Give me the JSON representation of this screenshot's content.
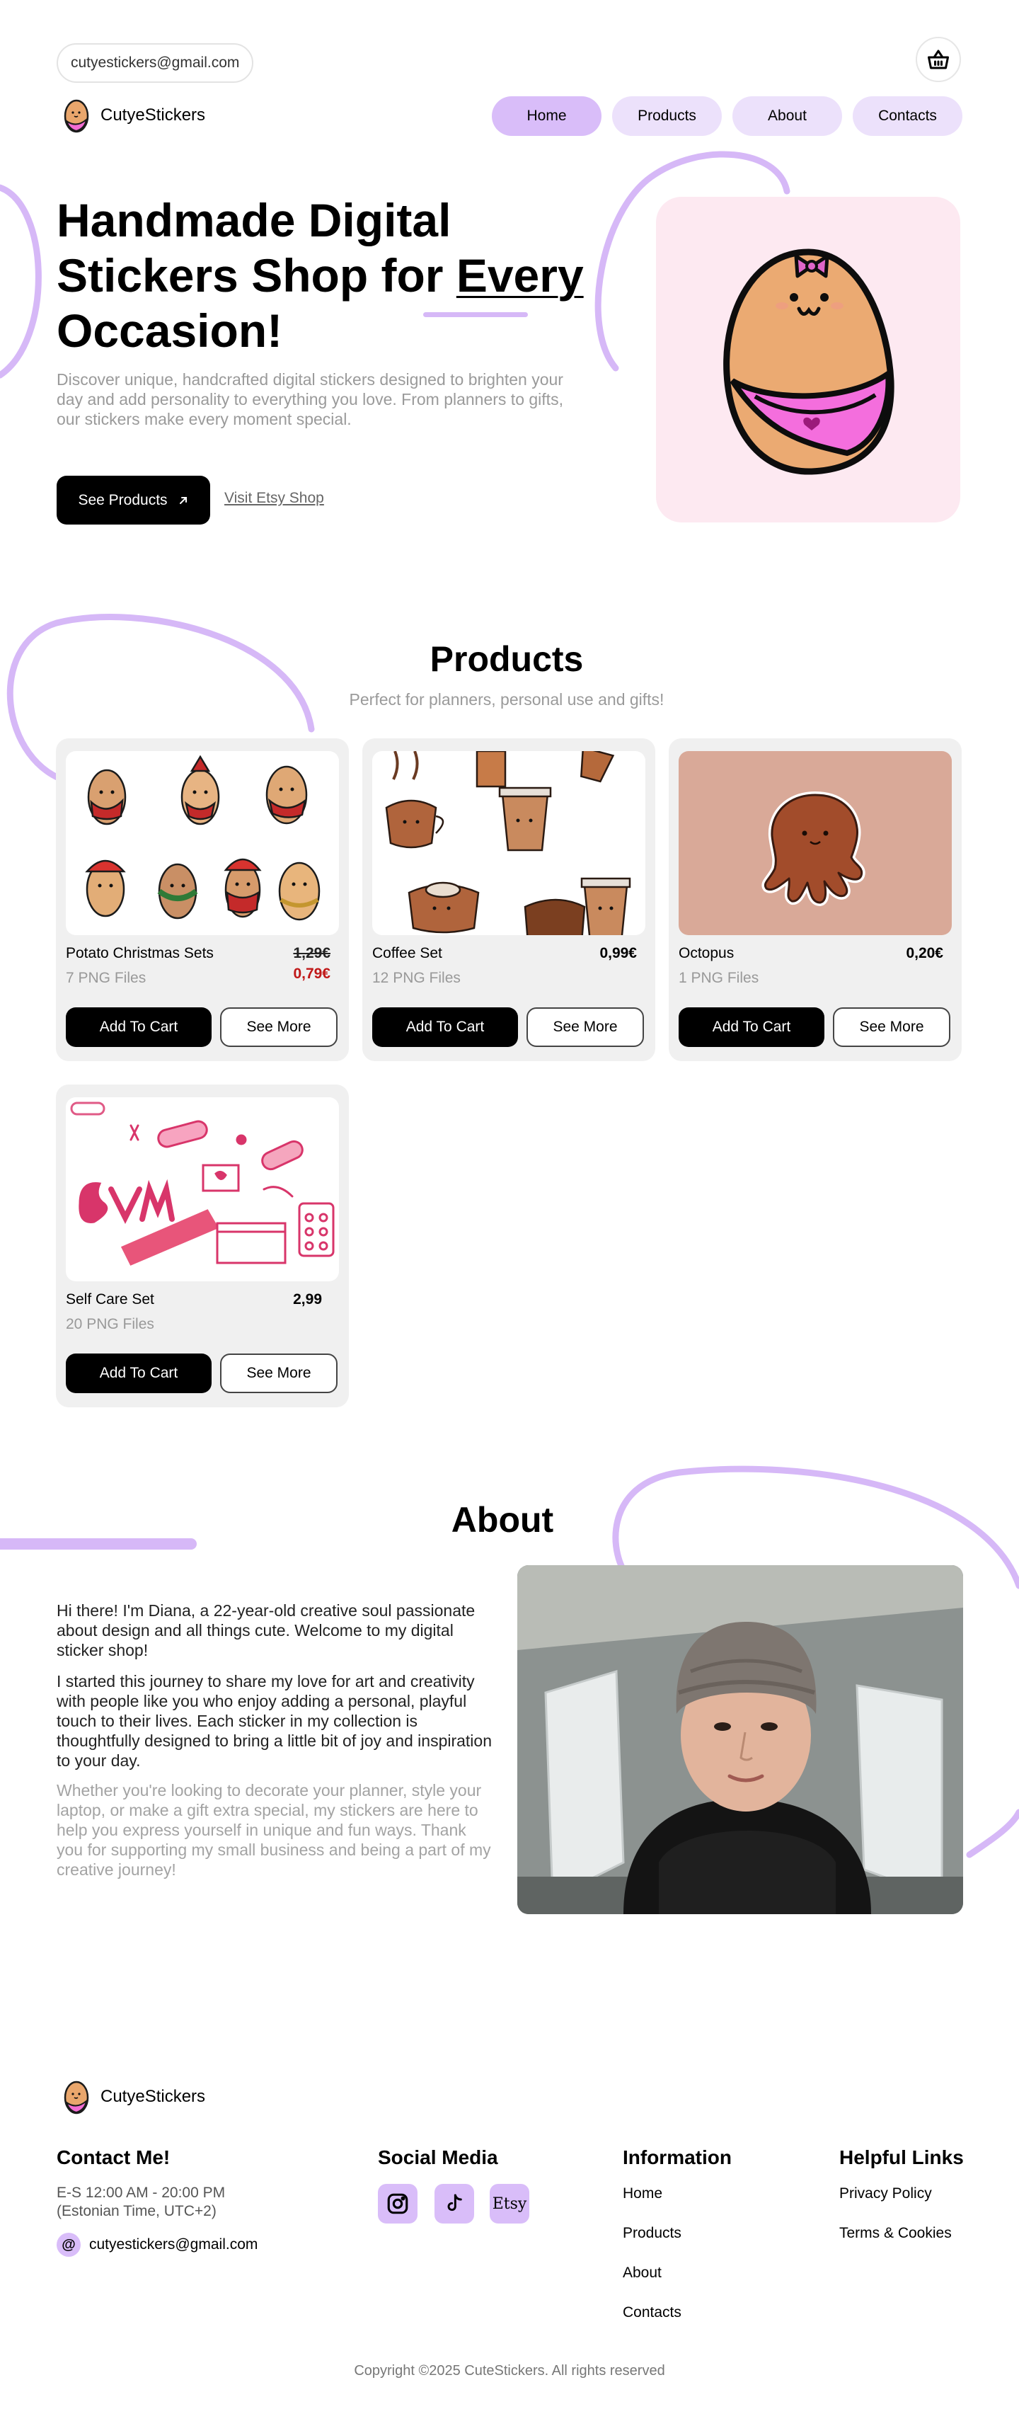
{
  "header": {
    "email": "cutyestickers@gmail.com",
    "brand": "CutyeStickers",
    "nav": [
      "Home",
      "Products",
      "About",
      "Contacts"
    ],
    "active_nav": "Home"
  },
  "hero": {
    "title_bold_1": "Handmade Digital",
    "title_bold_2": "Stickers",
    "title_plain": " Shop for ",
    "title_underlined": "Every",
    "title_line3": "Occasion!",
    "description": "Discover unique, handcrafted digital stickers designed to brighten your day and add personality to everything you love. From planners to gifts, our stickers make every moment special.",
    "cta_label": "See Products",
    "etsy_label": "Visit Etsy Shop"
  },
  "products": {
    "title": "Products",
    "subtitle": "Perfect for planners, personal use and gifts!",
    "add_label": "Add To Cart",
    "more_label": "See More",
    "items": [
      {
        "name": "Potato Christmas Sets",
        "files": "7 PNG Files",
        "old_price": "1,29€",
        "price": "0,79€"
      },
      {
        "name": "Coffee Set",
        "files": "12 PNG Files",
        "price": "0,99€"
      },
      {
        "name": "Octopus",
        "files": "1 PNG Files",
        "price": "0,20€"
      },
      {
        "name": "Self Care Set",
        "files": "20 PNG Files",
        "price": "2,99"
      }
    ]
  },
  "about": {
    "title": "About",
    "p1": "Hi there! I'm Diana, a 22-year-old creative soul passionate about design and all things cute. Welcome to my digital sticker shop!",
    "p2": "I started this journey to share my love for art and creativity with people like you who enjoy adding a personal, playful touch to their lives. Each sticker in my collection is thoughtfully designed to bring a little bit of joy and inspiration to your day.",
    "p3": "Whether you're looking to decorate your planner, style your laptop, or make a gift extra special, my stickers are here to help you express yourself in unique and fun ways. Thank you for supporting my small business and being a part of my creative journey!"
  },
  "footer": {
    "brand": "CutyeStickers",
    "contact_title": "Contact Me!",
    "hours_line1": "E-S 12:00 AM - 20:00 PM",
    "hours_line2": "(Estonian Time, UTC+2)",
    "email": "cutyestickers@gmail.com",
    "social_title": "Social Media",
    "etsy_text": "Etsy",
    "info_title": "Information",
    "info_links": [
      "Home",
      "Products",
      "About",
      "Contacts"
    ],
    "help_title": "Helpful Links",
    "help_links": [
      "Privacy Policy",
      "Terms & Cookies"
    ],
    "copyright": "Copyright ©2025 CuteStickers. All rights reserved"
  },
  "colors": {
    "accent": "#d9bdf9",
    "accent_light": "#ece1fb",
    "hero_card": "#fde9f1",
    "sale": "#c01818"
  }
}
